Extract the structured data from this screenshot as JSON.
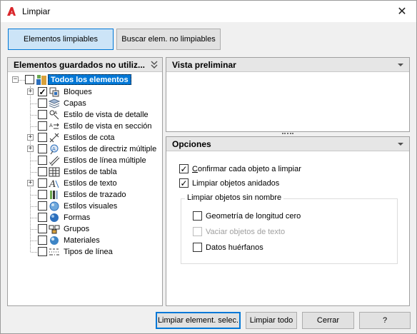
{
  "window": {
    "title": "Limpiar",
    "close_glyph": "✕"
  },
  "tabs": {
    "purgeable": {
      "label": "Elementos limpiables",
      "active": true
    },
    "non_purgeable": {
      "label": "Buscar elem. no limpiables",
      "active": false
    }
  },
  "tree_panel": {
    "header": "Elementos guardados no utiliz...",
    "root": {
      "label": "Todos los elementos",
      "checked": false,
      "expanded": true
    },
    "items": [
      {
        "label": "Bloques",
        "checked": true,
        "expandable": true,
        "icon": "block-icon"
      },
      {
        "label": "Capas",
        "checked": false,
        "expandable": false,
        "icon": "layers-icon"
      },
      {
        "label": "Estilo de vista de detalle",
        "checked": false,
        "expandable": false,
        "icon": "detail-view-style-icon"
      },
      {
        "label": "Estilo de vista en sección",
        "checked": false,
        "expandable": false,
        "icon": "section-view-style-icon"
      },
      {
        "label": "Estilos de cota",
        "checked": false,
        "expandable": true,
        "icon": "dimension-style-icon"
      },
      {
        "label": "Estilos de directriz múltiple",
        "checked": false,
        "expandable": true,
        "icon": "multileader-style-icon"
      },
      {
        "label": "Estilos de línea múltiple",
        "checked": false,
        "expandable": false,
        "icon": "multiline-style-icon"
      },
      {
        "label": "Estilos de tabla",
        "checked": false,
        "expandable": false,
        "icon": "table-style-icon"
      },
      {
        "label": "Estilos de texto",
        "checked": false,
        "expandable": true,
        "icon": "text-style-icon"
      },
      {
        "label": "Estilos de trazado",
        "checked": false,
        "expandable": false,
        "icon": "plot-style-icon"
      },
      {
        "label": "Estilos visuales",
        "checked": false,
        "expandable": false,
        "icon": "visual-style-icon"
      },
      {
        "label": "Formas",
        "checked": false,
        "expandable": false,
        "icon": "shapes-icon"
      },
      {
        "label": "Grupos",
        "checked": false,
        "expandable": false,
        "icon": "groups-icon"
      },
      {
        "label": "Materiales",
        "checked": false,
        "expandable": false,
        "icon": "materials-icon"
      },
      {
        "label": "Tipos de línea",
        "checked": false,
        "expandable": false,
        "icon": "linetype-icon"
      }
    ]
  },
  "preview_panel": {
    "header": "Vista preliminar"
  },
  "options_panel": {
    "header": "Opciones",
    "confirm": {
      "label": "Confirmar cada objeto a limpiar",
      "checked": true,
      "enabled": true
    },
    "nested": {
      "label": "Limpiar objetos anidados",
      "checked": true,
      "enabled": true
    },
    "unnamed_group": {
      "label": "Limpiar objetos sin nombre",
      "zero_length": {
        "label": "Geometría de longitud cero",
        "checked": false,
        "enabled": true
      },
      "empty_text": {
        "label": "Vaciar objetos de texto",
        "checked": false,
        "enabled": false
      },
      "orphan_data": {
        "label": "Datos huérfanos",
        "checked": false,
        "enabled": true
      }
    }
  },
  "buttons": {
    "purge_selected": "Limpiar element. selec.",
    "purge_all": "Limpiar todo",
    "close": "Cerrar",
    "help": "?"
  },
  "colors": {
    "accent": "#0078d7",
    "selection": "#0078d7",
    "autocad_red": "#d9262b"
  }
}
